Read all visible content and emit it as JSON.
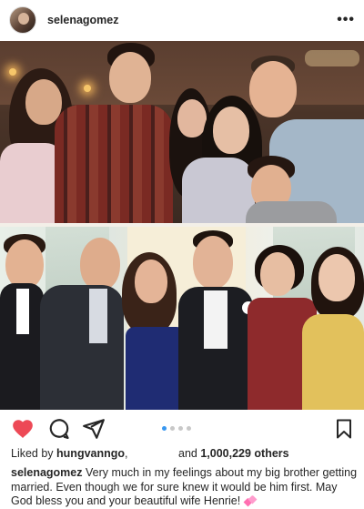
{
  "header": {
    "username": "selenagomez",
    "more_label": "•••"
  },
  "photo": {
    "carousel_total": 4,
    "carousel_active": 1
  },
  "actions": {
    "icons": [
      "heart-filled-icon",
      "comment-icon",
      "share-icon",
      "bookmark-icon"
    ],
    "like_color": "#ed4956"
  },
  "likes": {
    "prefix": "Liked by ",
    "user": "hungvanngo",
    "separator": ",",
    "and": "and ",
    "count": "1,000,229 others"
  },
  "caption": {
    "author": "selenagomez",
    "text": " Very much in my feelings about my big brother getting married. Even though we for sure knew it would be him first. May God bless you and your beautiful wife Henrie! "
  },
  "colors": {
    "accent_blue": "#3897f0",
    "text": "#262626"
  }
}
